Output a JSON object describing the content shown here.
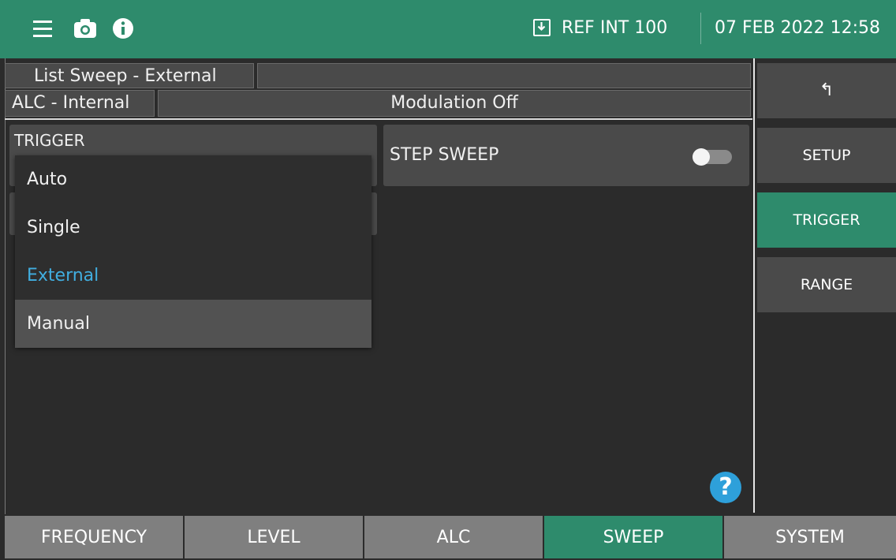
{
  "header": {
    "icons": [
      "menu-icon",
      "camera-icon",
      "info-icon",
      "download-icon"
    ],
    "reference": "REF INT 100",
    "datetime": "07 FEB 2022 12:58",
    "color": "#2e8b6c"
  },
  "status": {
    "sweep_mode": "List Sweep - External",
    "alc_mode": "ALC - Internal",
    "modulation": "Modulation Off"
  },
  "trigger_panel": {
    "label": "TRIGGER",
    "selected": "External",
    "options": [
      "Auto",
      "Single",
      "External",
      "Manual"
    ],
    "highlighted": "Manual"
  },
  "step_sweep": {
    "label": "STEP SWEEP",
    "enabled": false
  },
  "help": {
    "label": "?"
  },
  "side_menu": {
    "back_label": "↰",
    "items": [
      "SETUP",
      "TRIGGER",
      "RANGE"
    ],
    "active": "TRIGGER"
  },
  "tabs": {
    "items": [
      "FREQUENCY",
      "LEVEL",
      "ALC",
      "SWEEP",
      "SYSTEM"
    ],
    "active": "SWEEP"
  },
  "colors": {
    "accent": "#2e8b6c",
    "selected_text": "#41aee0",
    "help": "#2ea0da"
  }
}
